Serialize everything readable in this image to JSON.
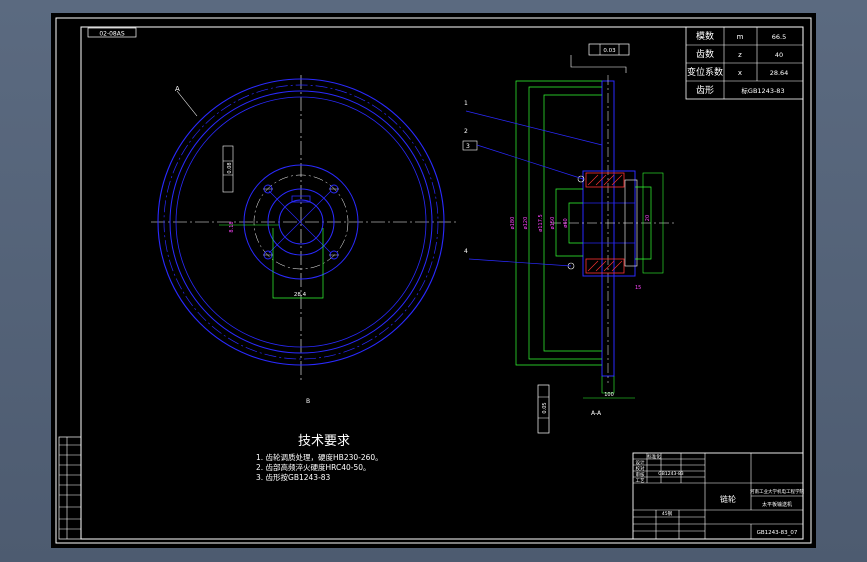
{
  "colors": {
    "frame": "#ffffff",
    "outline": "#2020ff",
    "dimension": "#00ff33",
    "center": "#ffffff",
    "annotation": "#ff33ff",
    "text": "#ffffff",
    "hatch": "#ff3333",
    "background": "#000000"
  },
  "drawing": {
    "drawing_code_box": "02-08AS",
    "label_a": "A",
    "label_b": "B",
    "section_label": "A-A",
    "dims": {
      "hub_offset": "28.4",
      "angle": "8.18",
      "tolerance_1": "0.08",
      "tolerance_2": "0.03",
      "run_tol": "0.05",
      "hub_width": "20",
      "bore": "ø60",
      "d1": "ø150",
      "d2": "ø117.5",
      "d3": "ø120",
      "d4": "ø180",
      "w_small": "15",
      "w_total": "100"
    },
    "leaders": [
      "1",
      "2",
      "3",
      "4"
    ]
  },
  "params_table": [
    {
      "label": "模数",
      "sym": "m",
      "value": "66.5"
    },
    {
      "label": "齿数",
      "sym": "z",
      "value": "40"
    },
    {
      "label": "变位系数",
      "sym": "x",
      "value": "28.64"
    },
    {
      "label": "齿形",
      "sym": "",
      "value": "标GB1243-83"
    }
  ],
  "tech": {
    "title": "技术要求",
    "items": [
      "1. 齿轮调质处理，硬度HB230-260。",
      "2. 齿部高频淬火硬度HRC40-50。",
      "3. 齿形按GB1243-83"
    ]
  },
  "title_block": {
    "company": "河南工业大学机电工程学院",
    "part_name": "链轮",
    "drawing_name": "太平板输送机",
    "drawing_no": "GB1243-83_07",
    "small_rows": [
      "设计",
      "校对",
      "审核",
      "工艺",
      "标准化"
    ],
    "sub_labels": [
      "GB1243-83",
      "45钢"
    ]
  },
  "left_column": [
    "",
    "",
    "",
    "",
    "",
    "",
    "",
    ""
  ]
}
